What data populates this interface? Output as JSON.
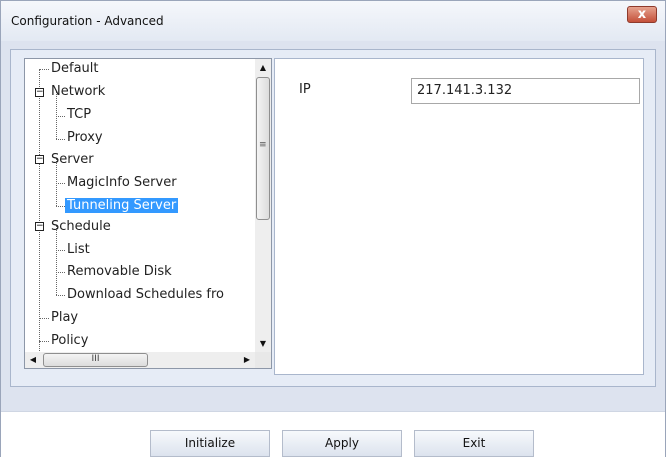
{
  "window": {
    "title": "Configuration - Advanced",
    "close_glyph": "x"
  },
  "tree": {
    "items": [
      {
        "label": "Default"
      },
      {
        "label": "Network"
      },
      {
        "label": "TCP"
      },
      {
        "label": "Proxy"
      },
      {
        "label": "Server"
      },
      {
        "label": "MagicInfo Server"
      },
      {
        "label": "Tunneling Server",
        "selected": true
      },
      {
        "label": "Schedule"
      },
      {
        "label": "List"
      },
      {
        "label": "Removable Disk"
      },
      {
        "label": "Download Schedules fro"
      },
      {
        "label": "Play"
      },
      {
        "label": "Policy"
      }
    ],
    "scroll_grip": "III",
    "vscroll_grip": "≡"
  },
  "panel": {
    "ip_label": "IP",
    "ip_value": "217.141.3.132"
  },
  "buttons": {
    "initialize": "Initialize",
    "apply": "Apply",
    "exit": "Exit"
  }
}
